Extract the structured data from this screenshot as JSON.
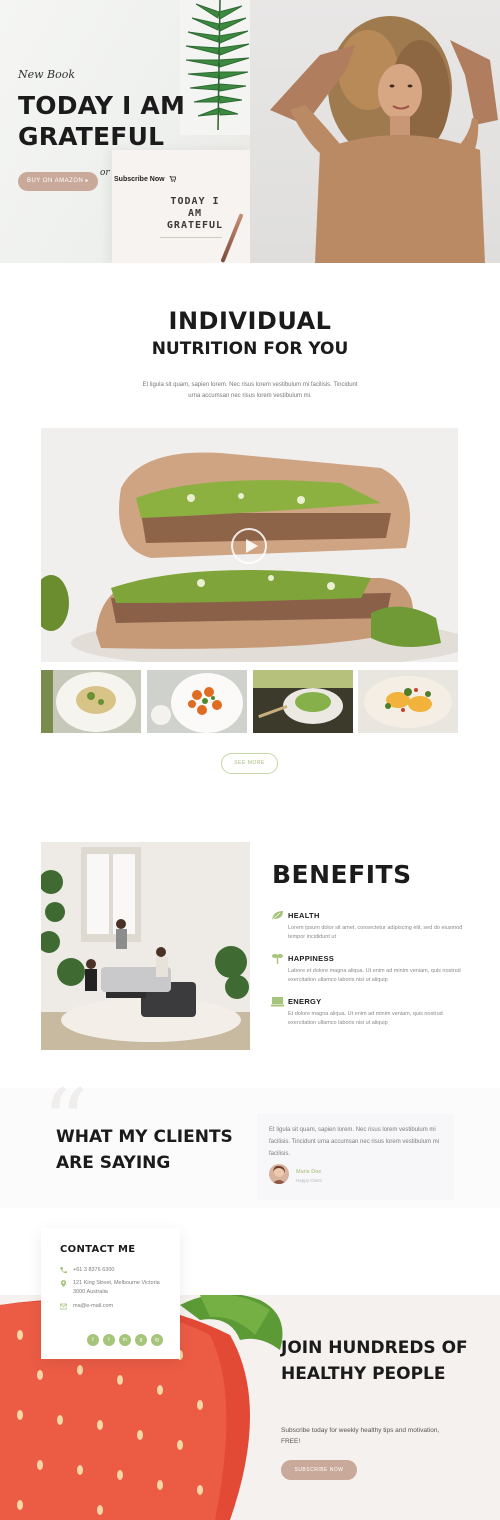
{
  "hero": {
    "subtitle": "New Book",
    "title": "TODAY I AM GRATEFUL",
    "amazon_button": "BUY ON AMAZON",
    "or_label": "or",
    "subscribe_link": "Subscribe Now",
    "book_cover_text": "TODAY I AM GRATEFUL"
  },
  "nutrition": {
    "title_line1": "INDIVIDUAL",
    "title_line2": "NUTRITION FOR YOU",
    "text": "Et ligula sit quam, sapien lorem. Nec risus lorem vestibulum mi facilisis. Tincidunt urna accumsan nec risus lorem vestibulum mi.",
    "see_more_button": "SEE MORE"
  },
  "benefits": {
    "title": "BENEFITS",
    "items": [
      {
        "title": "HEALTH",
        "text": "Lorem ipsum dolor sit amet, consectetur adipiscing elit, sed do eiusmod tempor incididunt ut",
        "icon": "leaf-icon"
      },
      {
        "title": "HAPPINESS",
        "text": "Labore et dolore magna aliqua. Ut enim ad minim veniam, quis nostrud exercitation ullamco laboris nisi ut aliquip",
        "icon": "plant-icon"
      },
      {
        "title": "ENERGY",
        "text": "Et dolore magna aliqua. Ut enim ad minim veniam, quis nostrud exercitation ullamco laboris nisi ut aliquip",
        "icon": "laptop-icon"
      }
    ]
  },
  "testimonials": {
    "title": "WHAT MY CLIENTS ARE SAYING",
    "quote": "Et ligula sit quam, sapien lorem. Nec risus lorem vestibulum mi facilisis. Tincidunt urna accumsan nec risus lorem vestibulum mi facilisis.",
    "client_name": "Marie Doe",
    "client_role": "Happy Client"
  },
  "contact": {
    "title": "CONTACT ME",
    "phone": "+61 3 8376 6300",
    "address": "121 King Street, Melbourne Victoria 3000 Australia",
    "email": "ma@e-mail.com",
    "social": [
      "f",
      "t",
      "in",
      "g",
      "ig"
    ]
  },
  "cta": {
    "title": "JOIN HUNDREDS OF HEALTHY PEOPLE",
    "text": "Subscribe today for weekly healthy tips and motivation, FREE!",
    "button": "SUBSCRIBE NOW"
  },
  "colors": {
    "accent_rose": "#c9a99a",
    "accent_green": "#a7c47b",
    "text_dark": "#1b1b1b"
  }
}
